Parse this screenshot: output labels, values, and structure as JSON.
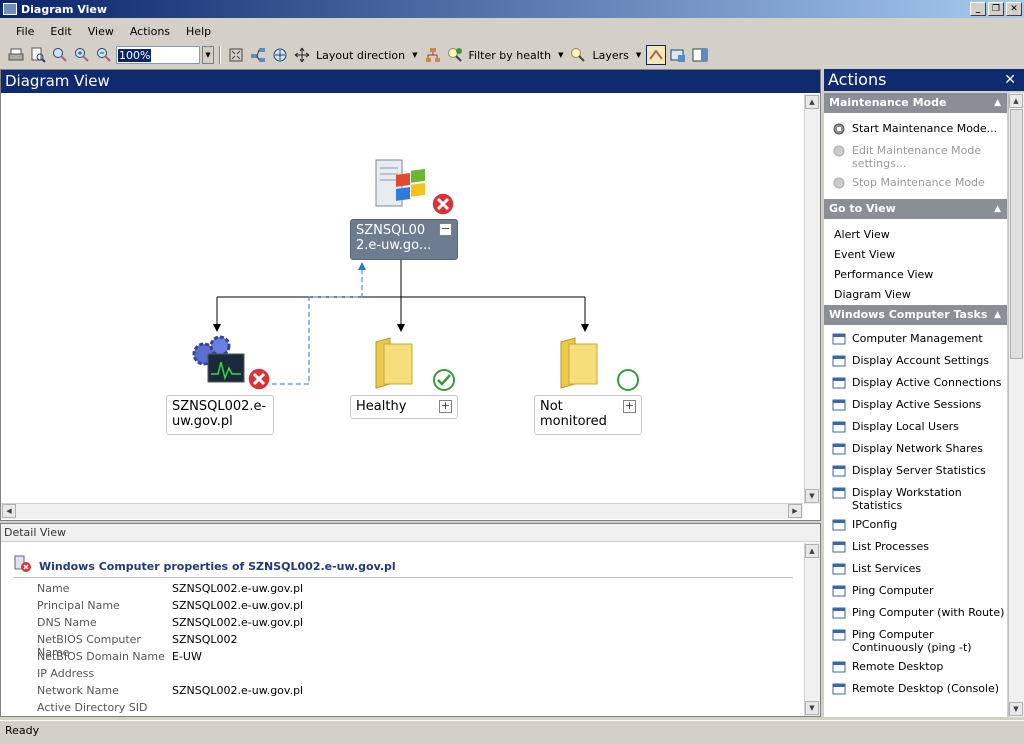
{
  "window": {
    "title": "Diagram View"
  },
  "menu": [
    "File",
    "Edit",
    "View",
    "Actions",
    "Help"
  ],
  "toolbar": {
    "zoom_value": "100%",
    "layout_direction": "Layout direction",
    "filter_by_health": "Filter by health",
    "layers": "Layers"
  },
  "diagram": {
    "header": "Diagram View",
    "root": {
      "label_line1": "SZNSQL00",
      "label_line2": "2.e-uw.go...",
      "state": "critical",
      "expander": "−"
    },
    "children": [
      {
        "label_line1": "SZNSQL002.e-",
        "label_line2": "uw.gov.pl",
        "state": "critical"
      },
      {
        "label_line1": "Healthy",
        "label_line2": "",
        "state": "healthy",
        "expander": "+"
      },
      {
        "label_line1": "Not",
        "label_line2": "monitored",
        "state": "not-monitored",
        "expander": "+"
      }
    ]
  },
  "detail": {
    "header": "Detail View",
    "title": "Windows Computer properties of SZNSQL002.e-uw.gov.pl",
    "properties": [
      {
        "key": "Name",
        "value": "SZNSQL002.e-uw.gov.pl"
      },
      {
        "key": "Principal Name",
        "value": "SZNSQL002.e-uw.gov.pl"
      },
      {
        "key": "DNS Name",
        "value": "SZNSQL002.e-uw.gov.pl"
      },
      {
        "key": "NetBIOS Computer Name",
        "value": "SZNSQL002"
      },
      {
        "key": "NetBIOS Domain Name",
        "value": "E-UW"
      },
      {
        "key": "IP Address",
        "value": ""
      },
      {
        "key": "Network Name",
        "value": "SZNSQL002.e-uw.gov.pl"
      },
      {
        "key": "Active Directory SID",
        "value": ""
      }
    ]
  },
  "actions": {
    "header": "Actions",
    "sections": [
      {
        "title": "Maintenance Mode",
        "items": [
          {
            "label": "Start Maintenance Mode...",
            "disabled": false
          },
          {
            "label": "Edit Maintenance Mode settings...",
            "disabled": true
          },
          {
            "label": "Stop Maintenance Mode",
            "disabled": true
          }
        ]
      },
      {
        "title": "Go to View",
        "items": [
          {
            "label": "Alert View"
          },
          {
            "label": "Event View"
          },
          {
            "label": "Performance View"
          },
          {
            "label": "Diagram View"
          }
        ]
      },
      {
        "title": "Windows Computer Tasks",
        "items": [
          {
            "label": "Computer Management"
          },
          {
            "label": "Display Account Settings"
          },
          {
            "label": "Display Active Connections"
          },
          {
            "label": "Display Active Sessions"
          },
          {
            "label": "Display Local Users"
          },
          {
            "label": "Display Network Shares"
          },
          {
            "label": "Display Server Statistics"
          },
          {
            "label": "Display Workstation Statistics"
          },
          {
            "label": "IPConfig"
          },
          {
            "label": "List Processes"
          },
          {
            "label": "List Services"
          },
          {
            "label": "Ping Computer"
          },
          {
            "label": "Ping Computer (with Route)"
          },
          {
            "label": "Ping Computer Continuously (ping -t)"
          },
          {
            "label": "Remote Desktop"
          },
          {
            "label": "Remote Desktop (Console)"
          }
        ]
      }
    ]
  },
  "status": {
    "text": "Ready"
  },
  "colors": {
    "title_bar": "#0a246a",
    "pane_header": "#0f2a6e",
    "section_head": "#8a8f96",
    "critical": "#d9333a",
    "healthy": "#3a9a3a"
  }
}
